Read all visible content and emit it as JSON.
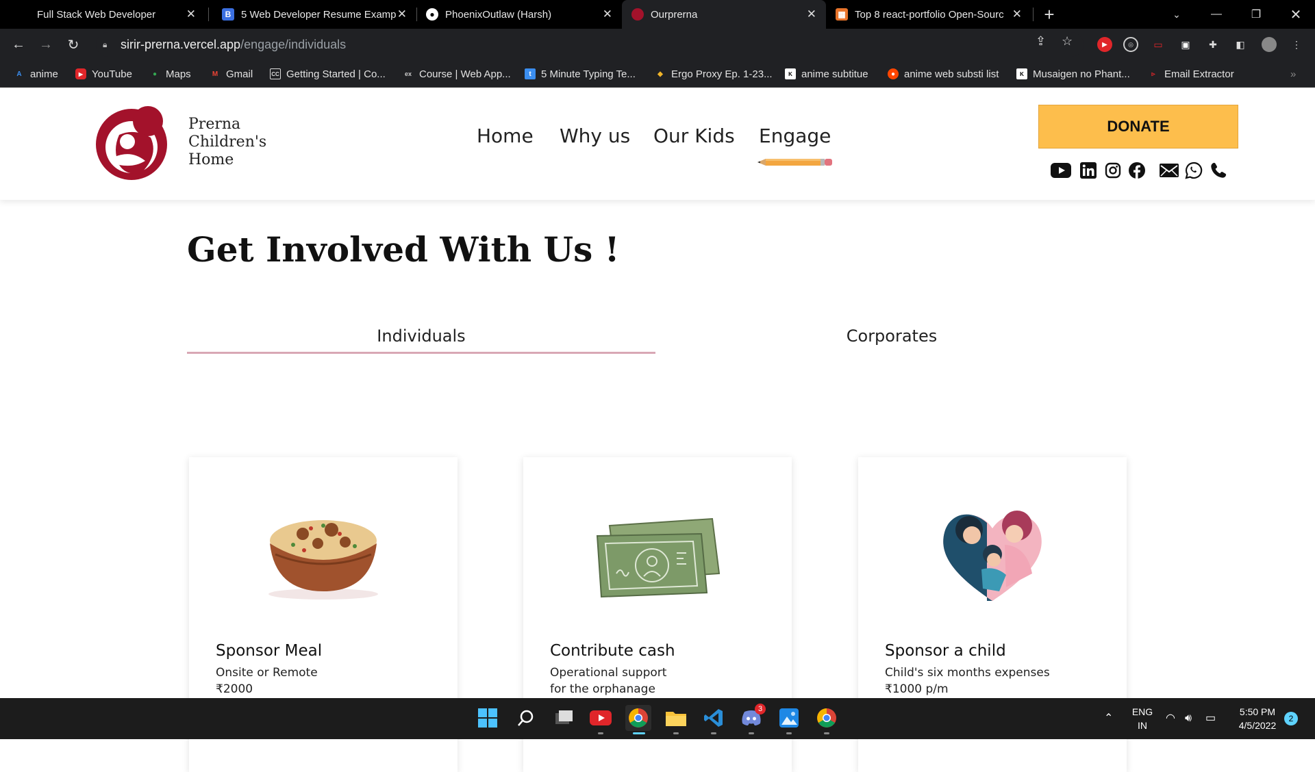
{
  "browser": {
    "tabs": [
      {
        "title": "Full Stack Web Developer",
        "icon": "tab-favicon-none"
      },
      {
        "title": "5 Web Developer Resume Examp",
        "icon": "b-icon"
      },
      {
        "title": "PhoenixOutlaw (Harsh)",
        "icon": "github-icon"
      },
      {
        "title": "Ourprerna",
        "icon": "prerna-icon"
      },
      {
        "title": "Top 8 react-portfolio Open-Sourc",
        "icon": "grid-icon"
      }
    ],
    "url_host": "sirir-prerna.vercel.app",
    "url_path": "/engage/individuals",
    "bookmarks": [
      "anime",
      "YouTube",
      "Maps",
      "Gmail",
      "Getting Started | Co...",
      "Course | Web App...",
      "5 Minute Typing Te...",
      "Ergo Proxy Ep. 1-23...",
      "anime subtitue",
      "anime web substi list",
      "Musaigen no Phant...",
      "Email Extractor"
    ]
  },
  "site": {
    "brand": "Prerna\nChildren's\nHome",
    "nav": [
      "Home",
      "Why us",
      "Our Kids",
      "Engage"
    ],
    "donate_label": "DONATE",
    "accent": "#a3122b",
    "donate_color": "#fdbe4c",
    "social_icons": [
      "youtube-icon",
      "linkedin-icon",
      "instagram-icon",
      "facebook-icon",
      "mail-icon",
      "whatsapp-icon",
      "phone-icon"
    ]
  },
  "main": {
    "title": "Get Involved With Us !",
    "tabs": [
      "Individuals",
      "Corporates"
    ],
    "active_tab": "Individuals",
    "cards": [
      {
        "title": "Sponsor Meal",
        "line1": "Onsite or Remote",
        "line2": "₹2000",
        "icon": "meal-bowl-icon"
      },
      {
        "title": "Contribute cash",
        "line1": "Operational support",
        "line2": "for the orphanage",
        "icon": "cash-icon"
      },
      {
        "title": "Sponsor a child",
        "line1": "Child's six months expenses",
        "line2": "₹1000 p/m",
        "icon": "family-heart-icon"
      }
    ]
  },
  "taskbar": {
    "lang1": "ENG",
    "lang2": "IN",
    "time": "5:50 PM",
    "date": "4/5/2022",
    "discord_badge": "3",
    "notif_count": "2"
  }
}
